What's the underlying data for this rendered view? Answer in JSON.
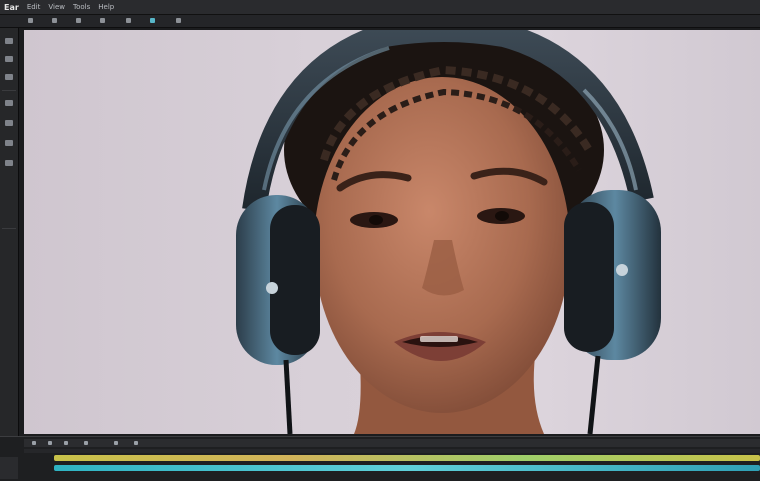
{
  "app": {
    "brand": "Ear",
    "menu": [
      "Edit",
      "View",
      "Tools",
      "Help"
    ]
  },
  "toolbar": {
    "icons": [
      "select-tool-icon",
      "move-tool-icon",
      "crop-tool-icon",
      "brush-tool-icon",
      "text-tool-icon",
      "layer-icon",
      "settings-icon"
    ]
  },
  "left_tools": {
    "icons": [
      "cursor-icon",
      "hand-icon",
      "zoom-icon",
      "pen-icon",
      "eraser-icon",
      "fill-icon",
      "eyedropper-icon"
    ]
  },
  "timeline": {
    "track_colors": [
      "#c8c24a",
      "#2fb3c2",
      "#5fd0d9"
    ]
  },
  "colors": {
    "ui_dark": "#1b1c1e",
    "panel": "#2a2b2e",
    "background_canvas": "#d8d0d8",
    "headphone_accent": "#4a6f86"
  }
}
